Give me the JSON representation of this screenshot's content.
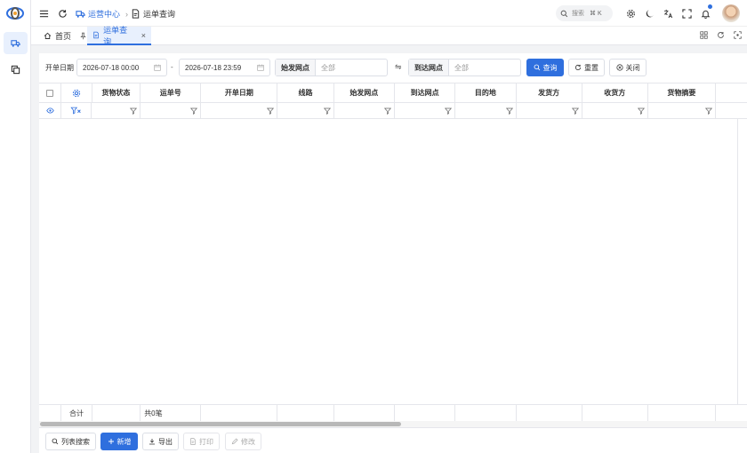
{
  "header": {
    "breadcrumb_parent": "运营中心",
    "breadcrumb_separator": "›",
    "breadcrumb_current": "运单查询",
    "search_placeholder": "搜索",
    "search_shortcut": "⌘ K"
  },
  "tabs": [
    {
      "label": "首页"
    },
    {
      "label": "运单查询",
      "close": "×"
    }
  ],
  "filters": {
    "date_label": "开单日期",
    "date_start": "2026-07-18 00:00",
    "date_sep": "-",
    "date_end": "2026-07-18 23:59",
    "origin_label": "始发网点",
    "origin_value": "全部",
    "swap": "⇋",
    "dest_label": "到达网点",
    "dest_value": "全部",
    "query": "查询",
    "reset": "重置",
    "close": "关闭"
  },
  "table": {
    "columns": [
      "货物状态",
      "运单号",
      "开单日期",
      "线路",
      "始发网点",
      "到达网点",
      "目的地",
      "发货方",
      "收货方",
      "货物摘要"
    ],
    "footer_label": "合计",
    "footer_count": "共0笔"
  },
  "actions": {
    "list_search": "列表搜索",
    "add": "新增",
    "export": "导出",
    "print": "打印",
    "edit": "修改"
  },
  "colors": {
    "accent": "#2f6fde"
  }
}
